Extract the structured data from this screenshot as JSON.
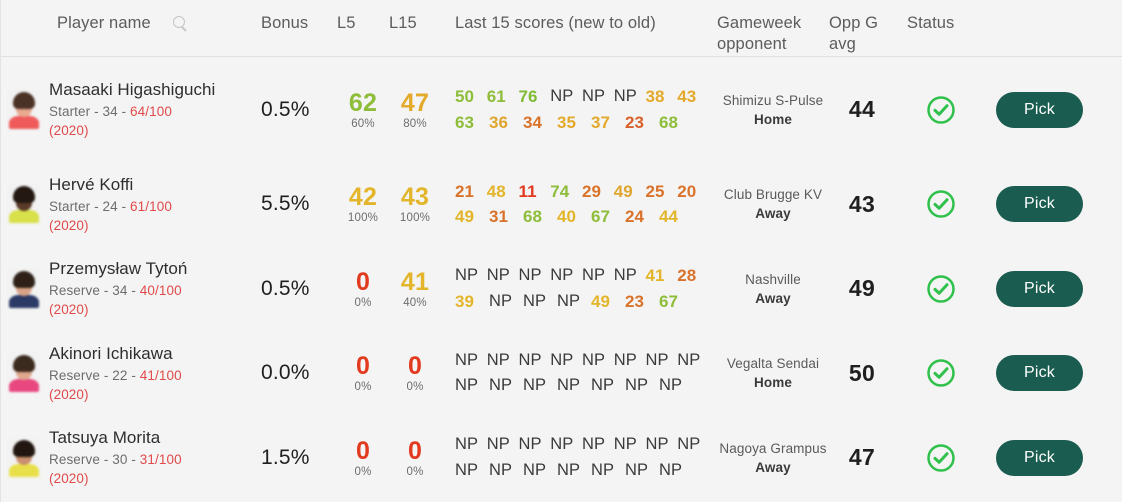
{
  "header": {
    "player_name": "Player name",
    "search_icon": "search-icon",
    "bonus": "Bonus",
    "l5": "L5",
    "l15": "L15",
    "scores": "Last 15 scores (new to old)",
    "opponent_line1": "Gameweek",
    "opponent_line2": "opponent",
    "oppg_line1": "Opp G",
    "oppg_line2": "avg",
    "status": "Status"
  },
  "colors": {
    "pick_button": "#1a5c4f",
    "status_ok": "#2fc14b",
    "score_red": "#e23a1f",
    "score_orange": "#d9732b",
    "score_amber": "#e3a92b",
    "score_yellow": "#e0bb2e",
    "score_green_light": "#8ebd3a",
    "score_green": "#7fbb33",
    "np": "#3a3a3a",
    "rating": "#e04a4a"
  },
  "action_label": "Pick",
  "status_icon": "check-circle-icon",
  "rows": [
    {
      "name": "Masaaki Higashiguchi",
      "role": "Starter",
      "age": "34",
      "rating": "64/100",
      "year": "(2020)",
      "avatar": {
        "hair": "#4a3226",
        "face": "#e8a98f",
        "shirt": "#ef5a5a",
        "bg": "#f2f2f2"
      },
      "bonus": "0.5%",
      "l5": {
        "value": "62",
        "pct": "60%",
        "color": "#8ebd3a"
      },
      "l15": {
        "value": "47",
        "pct": "80%",
        "color": "#e3a92b"
      },
      "scores": [
        {
          "v": "50",
          "c": "#8ebd3a"
        },
        {
          "v": "61",
          "c": "#8ebd3a"
        },
        {
          "v": "76",
          "c": "#7fbb33"
        },
        {
          "v": "NP",
          "c": "#3a3a3a"
        },
        {
          "v": "NP",
          "c": "#3a3a3a"
        },
        {
          "v": "NP",
          "c": "#3a3a3a"
        },
        {
          "v": "38",
          "c": "#e3a92b"
        },
        {
          "v": "43",
          "c": "#e3a92b"
        },
        {
          "v": "63",
          "c": "#8ebd3a"
        },
        {
          "v": "36",
          "c": "#e0a52e"
        },
        {
          "v": "34",
          "c": "#d9732b"
        },
        {
          "v": "35",
          "c": "#e3a92b"
        },
        {
          "v": "37",
          "c": "#e3a92b"
        },
        {
          "v": "23",
          "c": "#d9602b"
        },
        {
          "v": "68",
          "c": "#8ebd3a"
        }
      ],
      "opponent": "Shimizu S-Pulse",
      "venue": "Home",
      "oppg": "44"
    },
    {
      "name": "Hervé Koffi",
      "role": "Starter",
      "age": "24",
      "rating": "61/100",
      "year": "(2020)",
      "avatar": {
        "hair": "#241812",
        "face": "#5a3a28",
        "shirt": "#d8e04a",
        "bg": "#f2f2f2"
      },
      "bonus": "5.5%",
      "l5": {
        "value": "42",
        "pct": "100%",
        "color": "#e3b52b"
      },
      "l15": {
        "value": "43",
        "pct": "100%",
        "color": "#e3b52b"
      },
      "scores": [
        {
          "v": "21",
          "c": "#d9732b"
        },
        {
          "v": "48",
          "c": "#e3b52b"
        },
        {
          "v": "11",
          "c": "#e23a1f"
        },
        {
          "v": "74",
          "c": "#8ebd3a"
        },
        {
          "v": "29",
          "c": "#d9732b"
        },
        {
          "v": "49",
          "c": "#e0a52e"
        },
        {
          "v": "25",
          "c": "#d9732b"
        },
        {
          "v": "20",
          "c": "#d9732b"
        },
        {
          "v": "49",
          "c": "#e3b52b"
        },
        {
          "v": "31",
          "c": "#d9732b"
        },
        {
          "v": "68",
          "c": "#8ebd3a"
        },
        {
          "v": "40",
          "c": "#e3b52b"
        },
        {
          "v": "67",
          "c": "#8ebd3a"
        },
        {
          "v": "24",
          "c": "#d9732b"
        },
        {
          "v": "44",
          "c": "#e3b52b"
        }
      ],
      "opponent": "Club Brugge KV",
      "venue": "Away",
      "oppg": "43"
    },
    {
      "name": "Przemysław Tytoń",
      "role": "Reserve",
      "age": "34",
      "rating": "40/100",
      "year": "(2020)",
      "avatar": {
        "hair": "#2e2017",
        "face": "#dba386",
        "shirt": "#2c3a66",
        "bg": "#f2f2f2"
      },
      "bonus": "0.5%",
      "l5": {
        "value": "0",
        "pct": "0%",
        "color": "#e23a1f"
      },
      "l15": {
        "value": "41",
        "pct": "40%",
        "color": "#e3b52b"
      },
      "scores": [
        {
          "v": "NP",
          "c": "#3a3a3a"
        },
        {
          "v": "NP",
          "c": "#3a3a3a"
        },
        {
          "v": "NP",
          "c": "#3a3a3a"
        },
        {
          "v": "NP",
          "c": "#3a3a3a"
        },
        {
          "v": "NP",
          "c": "#3a3a3a"
        },
        {
          "v": "NP",
          "c": "#3a3a3a"
        },
        {
          "v": "41",
          "c": "#e3b52b"
        },
        {
          "v": "28",
          "c": "#d9732b"
        },
        {
          "v": "39",
          "c": "#e3b52b"
        },
        {
          "v": "NP",
          "c": "#3a3a3a"
        },
        {
          "v": "NP",
          "c": "#3a3a3a"
        },
        {
          "v": "NP",
          "c": "#3a3a3a"
        },
        {
          "v": "49",
          "c": "#e3b52b"
        },
        {
          "v": "23",
          "c": "#d9732b"
        },
        {
          "v": "67",
          "c": "#8ebd3a"
        }
      ],
      "opponent": "Nashville",
      "venue": "Away",
      "oppg": "49"
    },
    {
      "name": "Akinori Ichikawa",
      "role": "Reserve",
      "age": "22",
      "rating": "41/100",
      "year": "(2020)",
      "avatar": {
        "hair": "#3b2a1e",
        "face": "#e0a88c",
        "shirt": "#e8487f",
        "bg": "#f2f2f2"
      },
      "bonus": "0.0%",
      "l5": {
        "value": "0",
        "pct": "0%",
        "color": "#e23a1f"
      },
      "l15": {
        "value": "0",
        "pct": "0%",
        "color": "#e23a1f"
      },
      "scores": [
        {
          "v": "NP",
          "c": "#3a3a3a"
        },
        {
          "v": "NP",
          "c": "#3a3a3a"
        },
        {
          "v": "NP",
          "c": "#3a3a3a"
        },
        {
          "v": "NP",
          "c": "#3a3a3a"
        },
        {
          "v": "NP",
          "c": "#3a3a3a"
        },
        {
          "v": "NP",
          "c": "#3a3a3a"
        },
        {
          "v": "NP",
          "c": "#3a3a3a"
        },
        {
          "v": "NP",
          "c": "#3a3a3a"
        },
        {
          "v": "NP",
          "c": "#3a3a3a"
        },
        {
          "v": "NP",
          "c": "#3a3a3a"
        },
        {
          "v": "NP",
          "c": "#3a3a3a"
        },
        {
          "v": "NP",
          "c": "#3a3a3a"
        },
        {
          "v": "NP",
          "c": "#3a3a3a"
        },
        {
          "v": "NP",
          "c": "#3a3a3a"
        },
        {
          "v": "NP",
          "c": "#3a3a3a"
        }
      ],
      "opponent": "Vegalta Sendai",
      "venue": "Home",
      "oppg": "50"
    },
    {
      "name": "Tatsuya Morita",
      "role": "Reserve",
      "age": "30",
      "rating": "31/100",
      "year": "(2020)",
      "avatar": {
        "hair": "#211610",
        "face": "#c98f6e",
        "shirt": "#e8e04a",
        "bg": "#f2f2f2"
      },
      "bonus": "1.5%",
      "l5": {
        "value": "0",
        "pct": "0%",
        "color": "#e23a1f"
      },
      "l15": {
        "value": "0",
        "pct": "0%",
        "color": "#e23a1f"
      },
      "scores": [
        {
          "v": "NP",
          "c": "#3a3a3a"
        },
        {
          "v": "NP",
          "c": "#3a3a3a"
        },
        {
          "v": "NP",
          "c": "#3a3a3a"
        },
        {
          "v": "NP",
          "c": "#3a3a3a"
        },
        {
          "v": "NP",
          "c": "#3a3a3a"
        },
        {
          "v": "NP",
          "c": "#3a3a3a"
        },
        {
          "v": "NP",
          "c": "#3a3a3a"
        },
        {
          "v": "NP",
          "c": "#3a3a3a"
        },
        {
          "v": "NP",
          "c": "#3a3a3a"
        },
        {
          "v": "NP",
          "c": "#3a3a3a"
        },
        {
          "v": "NP",
          "c": "#3a3a3a"
        },
        {
          "v": "NP",
          "c": "#3a3a3a"
        },
        {
          "v": "NP",
          "c": "#3a3a3a"
        },
        {
          "v": "NP",
          "c": "#3a3a3a"
        },
        {
          "v": "NP",
          "c": "#3a3a3a"
        }
      ],
      "opponent": "Nagoya Grampus",
      "venue": "Away",
      "oppg": "47"
    }
  ]
}
